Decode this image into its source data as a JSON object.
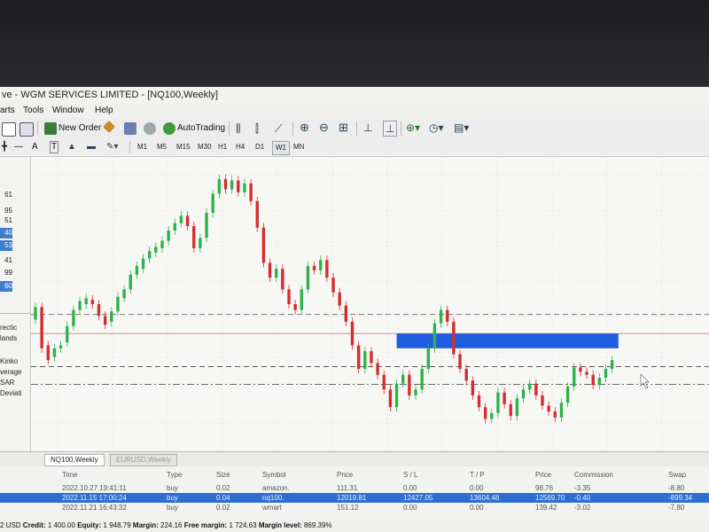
{
  "window": {
    "title": "ve - WGM SERVICES LIMITED - [NQ100,Weekly]"
  },
  "menu": [
    "arts",
    "Tools",
    "Window",
    "Help"
  ],
  "toolbar": {
    "new_order": "New Order",
    "autotrading": "AutoTrading"
  },
  "timeframes": [
    "M1",
    "M5",
    "M15",
    "M30",
    "H1",
    "H4",
    "D1",
    "W1",
    "MN"
  ],
  "active_timeframe": "W1",
  "sidebar": {
    "numbers": [
      "61",
      "95",
      "51",
      "40",
      "53",
      "41",
      "99",
      "60"
    ],
    "selected": [
      "40",
      "53",
      "60"
    ],
    "indicators": [
      "rectic",
      "lands",
      "Kinko",
      "verage",
      "SAR",
      "Deviati"
    ]
  },
  "chart_data": {
    "type": "candlestick",
    "symbol": "NQ100",
    "timeframe": "Weekly",
    "candles": [
      {
        "o": 11895,
        "c": 11980
      },
      {
        "o": 11980,
        "c": 11700
      },
      {
        "o": 11720,
        "c": 11620
      },
      {
        "o": 11640,
        "c": 11700
      },
      {
        "o": 11700,
        "c": 11720
      },
      {
        "o": 11740,
        "c": 11850
      },
      {
        "o": 11850,
        "c": 11960
      },
      {
        "o": 11960,
        "c": 12020
      },
      {
        "o": 12000,
        "c": 12040
      },
      {
        "o": 12030,
        "c": 12000
      },
      {
        "o": 12000,
        "c": 11920
      },
      {
        "o": 11920,
        "c": 11860
      },
      {
        "o": 11880,
        "c": 11950
      },
      {
        "o": 11950,
        "c": 12050
      },
      {
        "o": 12040,
        "c": 12100
      },
      {
        "o": 12100,
        "c": 12200
      },
      {
        "o": 12200,
        "c": 12260
      },
      {
        "o": 12240,
        "c": 12310
      },
      {
        "o": 12310,
        "c": 12360
      },
      {
        "o": 12350,
        "c": 12390
      },
      {
        "o": 12380,
        "c": 12430
      },
      {
        "o": 12430,
        "c": 12500
      },
      {
        "o": 12500,
        "c": 12550
      },
      {
        "o": 12550,
        "c": 12600
      },
      {
        "o": 12600,
        "c": 12530
      },
      {
        "o": 12530,
        "c": 12380
      },
      {
        "o": 12380,
        "c": 12450
      },
      {
        "o": 12450,
        "c": 12620
      },
      {
        "o": 12620,
        "c": 12750
      },
      {
        "o": 12750,
        "c": 12850
      },
      {
        "o": 12850,
        "c": 12780
      },
      {
        "o": 12780,
        "c": 12840
      },
      {
        "o": 12840,
        "c": 12760
      },
      {
        "o": 12760,
        "c": 12820
      },
      {
        "o": 12820,
        "c": 12700
      },
      {
        "o": 12700,
        "c": 12520
      },
      {
        "o": 12520,
        "c": 12280
      },
      {
        "o": 12280,
        "c": 12180
      },
      {
        "o": 12180,
        "c": 12240
      },
      {
        "o": 12240,
        "c": 12100
      },
      {
        "o": 12100,
        "c": 12000
      },
      {
        "o": 12000,
        "c": 11960
      },
      {
        "o": 11960,
        "c": 12100
      },
      {
        "o": 12100,
        "c": 12260
      },
      {
        "o": 12260,
        "c": 12230
      },
      {
        "o": 12230,
        "c": 12300
      },
      {
        "o": 12300,
        "c": 12180
      },
      {
        "o": 12180,
        "c": 12080
      },
      {
        "o": 12080,
        "c": 11990
      },
      {
        "o": 11990,
        "c": 11880
      },
      {
        "o": 11880,
        "c": 11720
      },
      {
        "o": 11720,
        "c": 11560
      },
      {
        "o": 11560,
        "c": 11680
      },
      {
        "o": 11680,
        "c": 11600
      },
      {
        "o": 11600,
        "c": 11520
      },
      {
        "o": 11520,
        "c": 11420
      },
      {
        "o": 11420,
        "c": 11300
      },
      {
        "o": 11300,
        "c": 11460
      },
      {
        "o": 11460,
        "c": 11520
      },
      {
        "o": 11520,
        "c": 11380
      },
      {
        "o": 11380,
        "c": 11420
      },
      {
        "o": 11420,
        "c": 11560
      },
      {
        "o": 11560,
        "c": 11700
      },
      {
        "o": 11700,
        "c": 11870
      },
      {
        "o": 11870,
        "c": 11960
      },
      {
        "o": 11960,
        "c": 11880
      },
      {
        "o": 11880,
        "c": 11660
      },
      {
        "o": 11660,
        "c": 11560
      },
      {
        "o": 11560,
        "c": 11480
      },
      {
        "o": 11480,
        "c": 11380
      },
      {
        "o": 11380,
        "c": 11300
      },
      {
        "o": 11300,
        "c": 11220
      },
      {
        "o": 11220,
        "c": 11260
      },
      {
        "o": 11260,
        "c": 11400
      },
      {
        "o": 11400,
        "c": 11320
      },
      {
        "o": 11320,
        "c": 11240
      },
      {
        "o": 11240,
        "c": 11360
      },
      {
        "o": 11360,
        "c": 11420
      },
      {
        "o": 11420,
        "c": 11460
      },
      {
        "o": 11460,
        "c": 11380
      },
      {
        "o": 11380,
        "c": 11310
      },
      {
        "o": 11310,
        "c": 11270
      },
      {
        "o": 11270,
        "c": 11230
      },
      {
        "o": 11230,
        "c": 11330
      },
      {
        "o": 11330,
        "c": 11440
      },
      {
        "o": 11440,
        "c": 11570
      },
      {
        "o": 11570,
        "c": 11540
      },
      {
        "o": 11540,
        "c": 11520
      },
      {
        "o": 11520,
        "c": 11450
      },
      {
        "o": 11450,
        "c": 11500
      },
      {
        "o": 11500,
        "c": 11560
      },
      {
        "o": 11560,
        "c": 11620
      }
    ],
    "ylim": [
      11000,
      13000
    ],
    "level_lines": [
      {
        "value": 11930,
        "style": "dash",
        "color": "#777777"
      },
      {
        "value": 11800,
        "style": "solid",
        "color": "#c87f7f"
      },
      {
        "value": 11575,
        "style": "dash",
        "color": "#444444"
      },
      {
        "value": 11455,
        "style": "dashdot",
        "color": "#555555"
      }
    ],
    "zone": {
      "high": 11800,
      "low": 11700,
      "start_index": 57,
      "end_index": 92,
      "color": "#1e5ce0"
    },
    "colors": {
      "up": "#2fb24a",
      "down": "#d52d2d"
    },
    "grid": true
  },
  "tabs": {
    "active": "NQ100,Weekly",
    "inactive": "EURUSD,Weekly"
  },
  "trade_table": {
    "headers": [
      "Time",
      "Type",
      "Size",
      "Symbol",
      "Price",
      "S / L",
      "T / P",
      "Price",
      "Commission",
      "Swap"
    ],
    "rows": [
      [
        "2022.10.27 19:41:11",
        "buy",
        "0.02",
        "amazon.",
        "111.31",
        "0.00",
        "0.00",
        "98.76",
        "-3.35",
        "-8.80"
      ],
      [
        "2022.11.15 17:00:24",
        "buy",
        "0.04",
        "nq100.",
        "12019.81",
        "12427.05",
        "13604.48",
        "12569.70",
        "-0.40",
        "-899.34"
      ],
      [
        "2022.11.21 16:43:32",
        "buy",
        "0.02",
        "wmart",
        "151.12",
        "0.00",
        "0.00",
        "139.42",
        "-3.02",
        "-7.80"
      ]
    ],
    "selected_row": 1
  },
  "status": {
    "balance": "2 USD",
    "credit_label": "Credit:",
    "credit": "1 400.00",
    "equity_label": "Equity:",
    "equity": "1 948.79",
    "margin_label": "Margin:",
    "margin": "224.16",
    "free_margin_label": "Free margin:",
    "free_margin": "1 724.63",
    "margin_level_label": "Margin level:",
    "margin_level": "869.39%"
  }
}
